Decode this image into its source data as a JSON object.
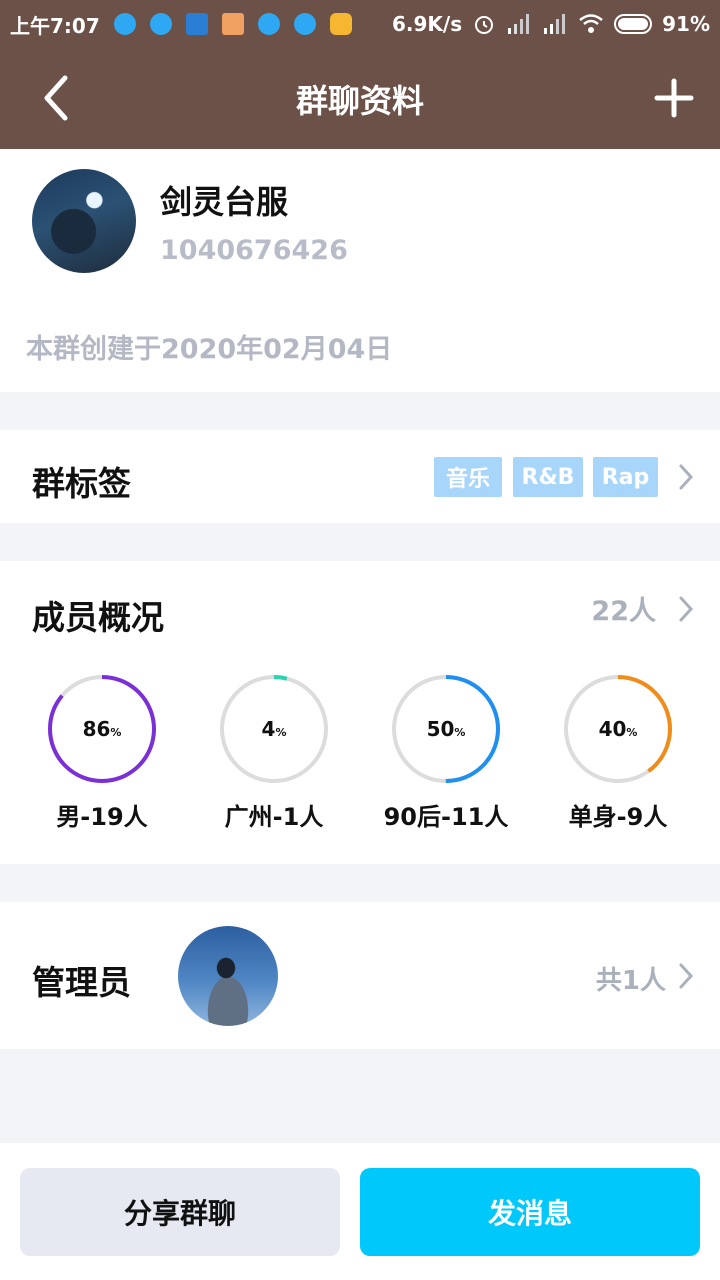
{
  "status_bar": {
    "time": "上午7:07",
    "network_speed": "6.9K/s",
    "battery": "91%"
  },
  "nav": {
    "title": "群聊资料",
    "back_icon": "chevron-left-icon",
    "add_icon": "plus-icon"
  },
  "group": {
    "name": "剑灵台服",
    "id": "1040676426",
    "created": "本群创建于2020年02月04日"
  },
  "tags": {
    "title": "群标签",
    "items": [
      "音乐",
      "R&B",
      "Rap"
    ]
  },
  "members": {
    "title": "成员概况",
    "count": "22人",
    "stats": [
      {
        "percent": "86",
        "unit": "%",
        "label": "男-19人",
        "value": 0.86,
        "color": "#7b2fd6"
      },
      {
        "percent": "4",
        "unit": "%",
        "label": "广州-1人",
        "value": 0.04,
        "color": "#2ad2b0"
      },
      {
        "percent": "50",
        "unit": "%",
        "label": "90后-11人",
        "value": 0.5,
        "color": "#1f8ff0"
      },
      {
        "percent": "40",
        "unit": "%",
        "label": "单身-9人",
        "value": 0.4,
        "color": "#f08c1a"
      }
    ]
  },
  "admin": {
    "title": "管理员",
    "count": "共1人"
  },
  "buttons": {
    "share": "分享群聊",
    "send": "发消息"
  }
}
